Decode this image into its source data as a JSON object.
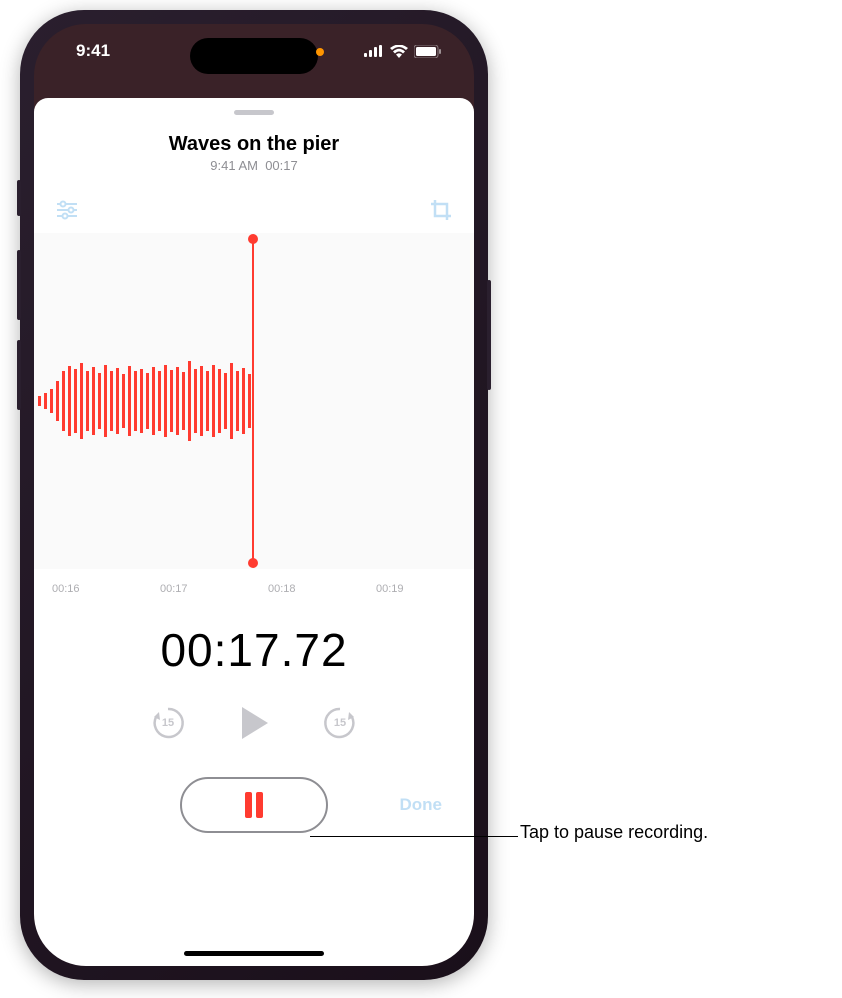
{
  "statusBar": {
    "time": "9:41"
  },
  "recording": {
    "title": "Waves on the pier",
    "subtitleTime": "9:41 AM",
    "subtitleDuration": "00:17"
  },
  "timeline": {
    "ticks": [
      "00:16",
      "00:17",
      "00:18",
      "00:19"
    ]
  },
  "timer": {
    "elapsed": "00:17.72"
  },
  "controls": {
    "skipBack": "15",
    "skipForward": "15",
    "doneLabel": "Done"
  },
  "annotation": {
    "pause": "Tap to pause recording."
  }
}
